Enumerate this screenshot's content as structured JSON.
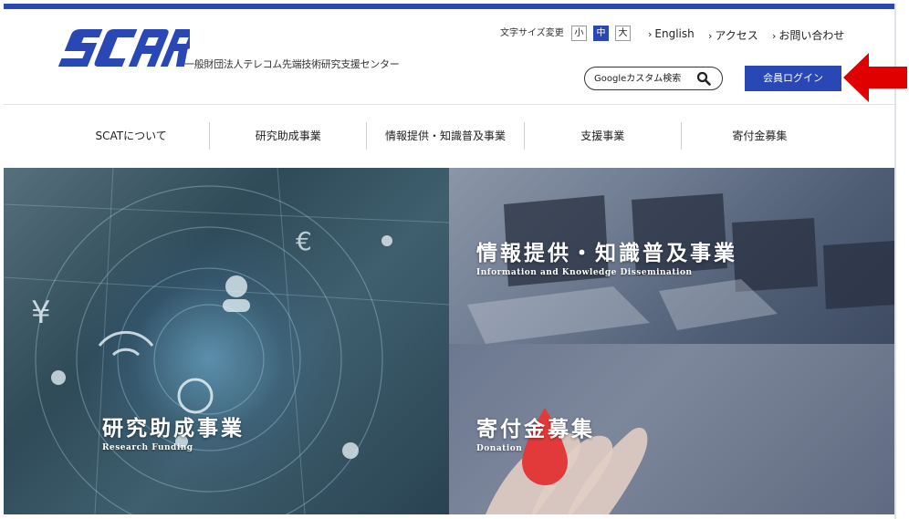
{
  "header": {
    "logo_alt": "SCAT",
    "org_name": "一般財団法人テレコム先端技術研究支援センター",
    "font_size": {
      "label": "文字サイズ変更",
      "options": [
        "小",
        "中",
        "大"
      ],
      "selected": "中"
    },
    "links": [
      {
        "label": "English"
      },
      {
        "label": "アクセス"
      },
      {
        "label": "お問い合わせ"
      }
    ],
    "search": {
      "placeholder": "Googleカスタム検索"
    },
    "login_label": "会員ログイン"
  },
  "nav": {
    "items": [
      {
        "label": "SCATについて"
      },
      {
        "label": "研究助成事業"
      },
      {
        "label": "情報提供・知識普及事業"
      },
      {
        "label": "支援事業"
      },
      {
        "label": "寄付金募集"
      }
    ]
  },
  "tiles": {
    "research": {
      "title": "研究助成事業",
      "subtitle": "Research Funding"
    },
    "info": {
      "title": "情報提供・知識普及事業",
      "subtitle": "Information and Knowledge Dissemination"
    },
    "donate": {
      "title": "寄付金募集",
      "subtitle": "Donation"
    }
  },
  "colors": {
    "brand_blue": "#2947b5",
    "arrow_red": "#e00000"
  },
  "icons": [
    "search-icon",
    "chevron-right-icon",
    "red-arrow-icon"
  ]
}
